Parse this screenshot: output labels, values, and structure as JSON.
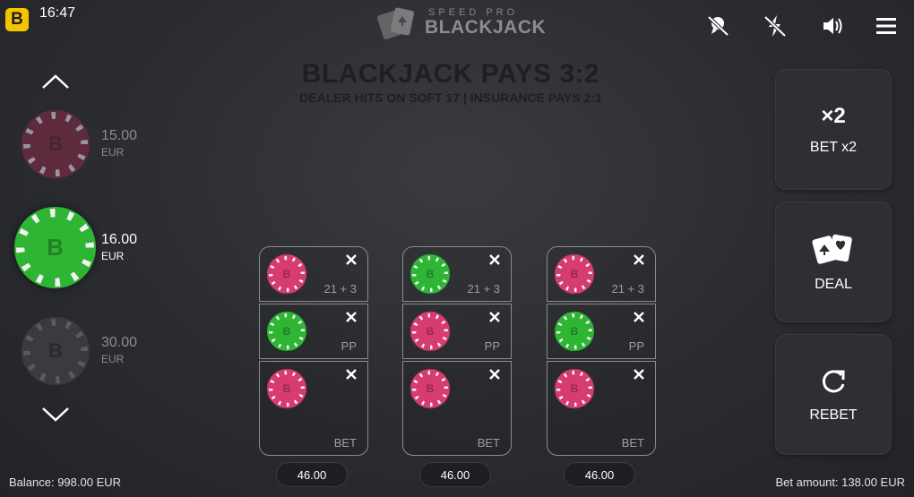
{
  "status_bar": {
    "app_logo": "B",
    "time": "16:47"
  },
  "brand": {
    "line1": "SPEED PRO",
    "line2": "BLACKJACK"
  },
  "table": {
    "title": "BLACKJACK PAYS 3:2",
    "subtitle": "DEALER HITS ON SOFT 17 | INSURANCE PAYS 2:1"
  },
  "chip_selector": {
    "chips": [
      {
        "value": "15.00",
        "currency": "EUR",
        "letter": "B",
        "color": "#8a2b4c",
        "selected": false
      },
      {
        "value": "16.00",
        "currency": "EUR",
        "letter": "B",
        "color": "#2fb534",
        "selected": true
      },
      {
        "value": "30.00",
        "currency": "EUR",
        "letter": "B",
        "color": "#3a3b3e",
        "selected": false
      }
    ]
  },
  "seats": [
    {
      "side_bet_label": "21 + 3",
      "pair_label": "PP",
      "main_label": "BET",
      "total": "46.00",
      "chips": {
        "side": "pink",
        "pair": "green",
        "main": "pink"
      }
    },
    {
      "side_bet_label": "21 + 3",
      "pair_label": "PP",
      "main_label": "BET",
      "total": "46.00",
      "chips": {
        "side": "green",
        "pair": "pink",
        "main": "pink"
      }
    },
    {
      "side_bet_label": "21 + 3",
      "pair_label": "PP",
      "main_label": "BET",
      "total": "46.00",
      "chips": {
        "side": "pink",
        "pair": "green",
        "main": "pink"
      }
    }
  ],
  "chip_colors": {
    "pink": "#d63c6f",
    "green": "#2fb534"
  },
  "actions": {
    "double": {
      "icon_text": "×2",
      "label": "BET x2"
    },
    "deal": {
      "label": "DEAL"
    },
    "rebet": {
      "label": "REBET"
    }
  },
  "footer": {
    "balance": "Balance: 998.00 EUR",
    "bet_amount": "Bet amount: 138.00 EUR"
  },
  "icons": [
    "app-logo",
    "brand-cards-icon",
    "no-chat-icon",
    "no-bolt-icon",
    "volume-icon",
    "menu-icon",
    "chevron-up-icon",
    "chevron-down-icon",
    "close-icon",
    "cards-icon",
    "rebet-icon"
  ]
}
